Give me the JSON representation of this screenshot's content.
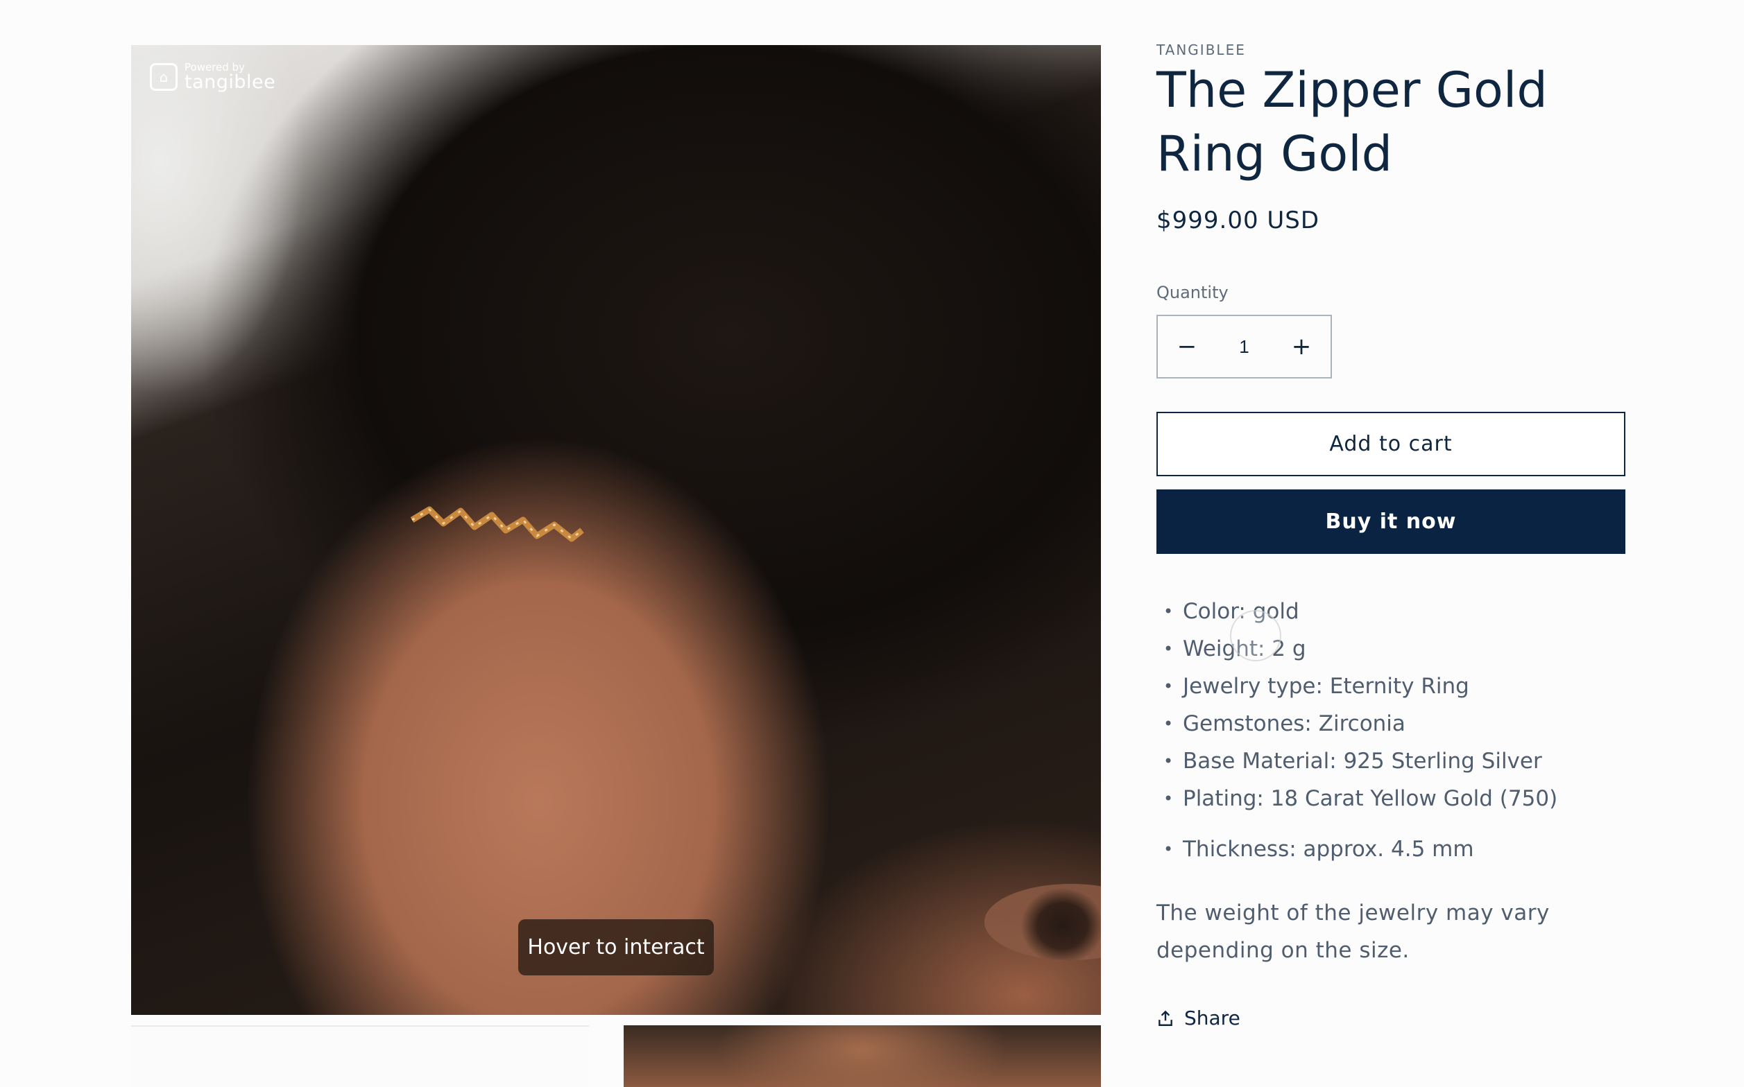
{
  "gallery": {
    "powered_by_small": "Powered by",
    "powered_by_brand": "tangiblee",
    "hover_hint": "Hover to interact"
  },
  "product": {
    "vendor": "TANGIBLEE",
    "title": "The Zipper Gold Ring Gold",
    "price": "$999.00 USD",
    "quantity_label": "Quantity",
    "quantity_value": "1",
    "decrease_symbol": "−",
    "increase_symbol": "+",
    "add_to_cart": "Add to cart",
    "buy_now": "Buy it now",
    "specs": [
      "Color: gold",
      "Weight: 2 g",
      "Jewelry type: Eternity Ring",
      "Gemstones: Zirconia",
      "Base Material: 925 Sterling Silver",
      "Plating: 18 Carat Yellow Gold (750)"
    ],
    "spec_extra": "Thickness: approx. 4.5 mm",
    "note": "The weight of the jewelry may vary depending on the size.",
    "share": "Share"
  },
  "colors": {
    "brand_navy": "#0a2342",
    "text_muted": "#4f5d6e"
  }
}
